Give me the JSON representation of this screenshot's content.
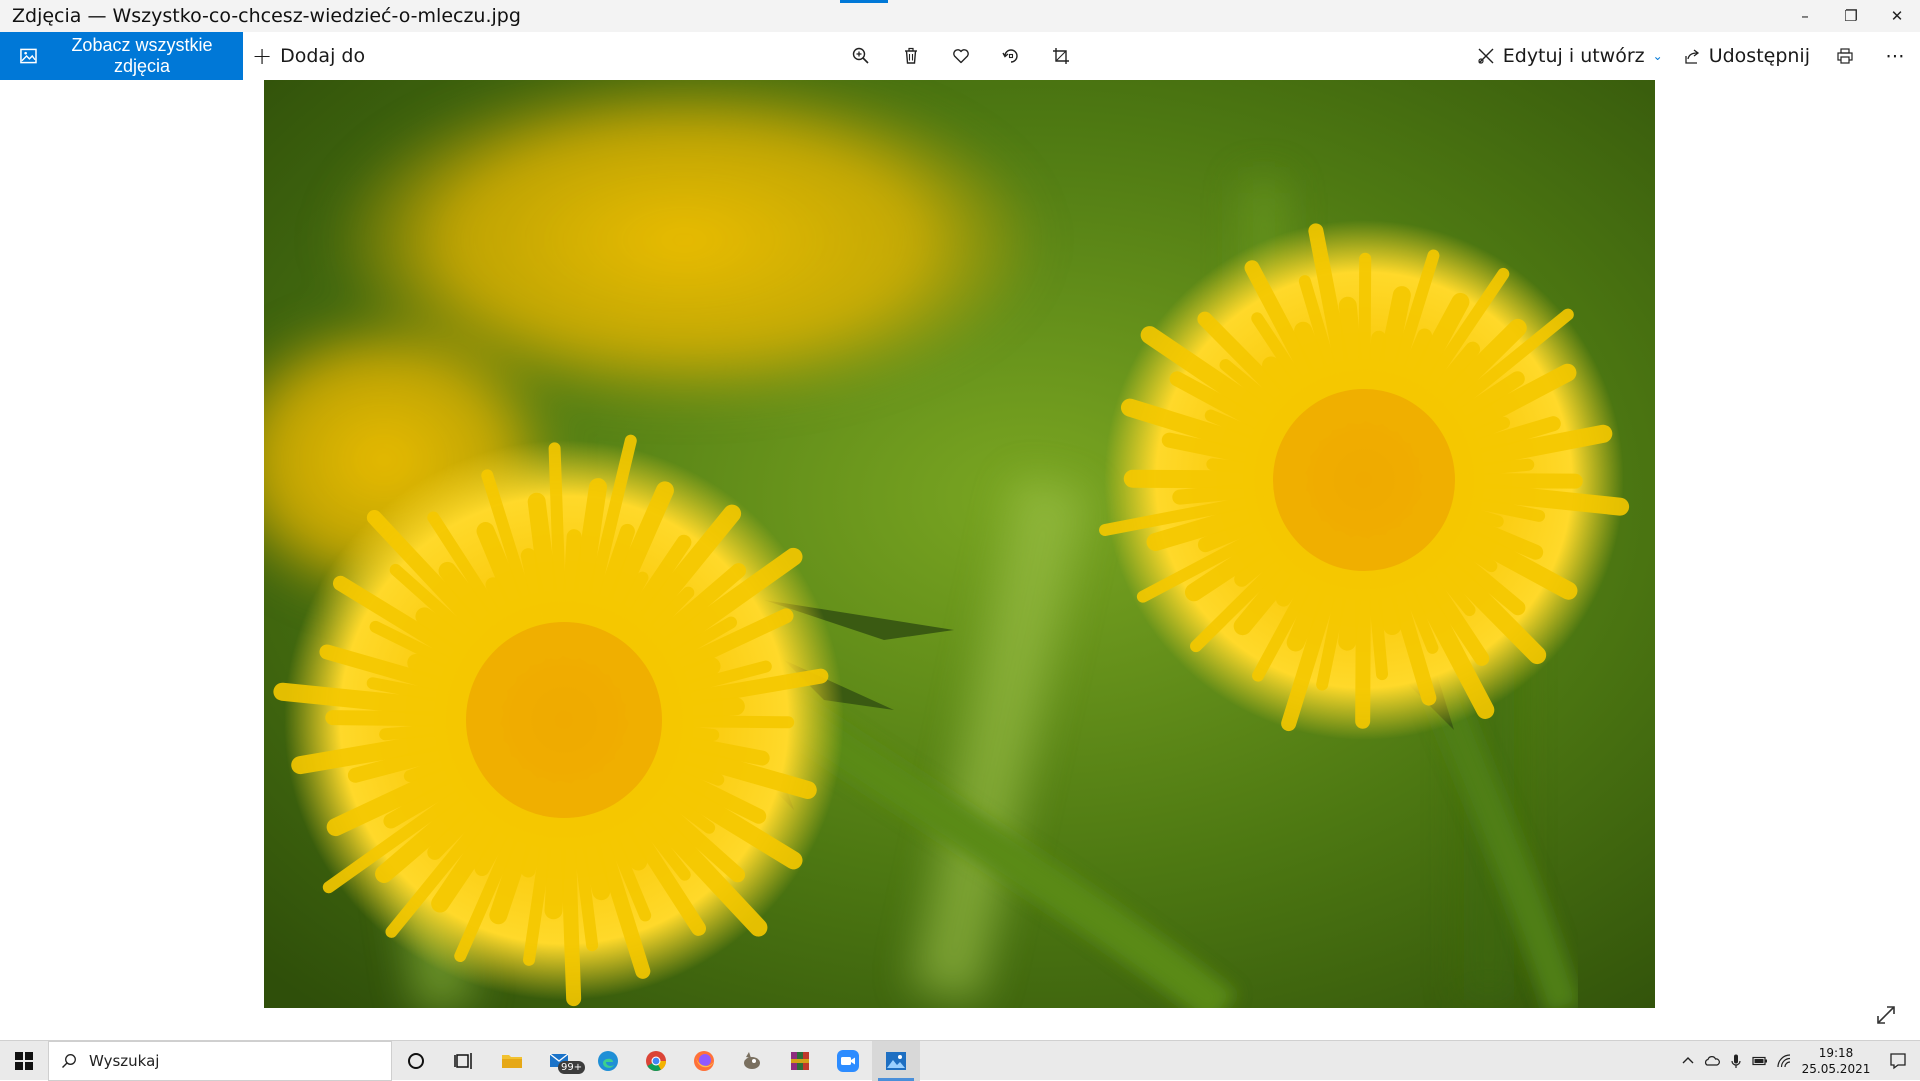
{
  "window": {
    "title": "Zdjęcia — Wszystko-co-chcesz-wiedzieć-o-mleczu.jpg",
    "minimize": "–",
    "restore": "❐",
    "close": "✕"
  },
  "toolbar": {
    "see_all_label": "Zobacz wszystkie zdjęcia",
    "add_to_plus": "+",
    "add_to_label": "Dodaj do",
    "edit_label": "Edytuj i utwórz",
    "edit_chevron": "⌄",
    "share_label": "Udostępnij",
    "more_label": "⋯"
  },
  "taskbar": {
    "search_placeholder": "Wyszukaj",
    "mail_badge": "99+",
    "time": "19:18",
    "date": "25.05.2021"
  },
  "colors": {
    "accent": "#0078d7",
    "petal": "#f5c800",
    "grass": "#4f7a12"
  }
}
